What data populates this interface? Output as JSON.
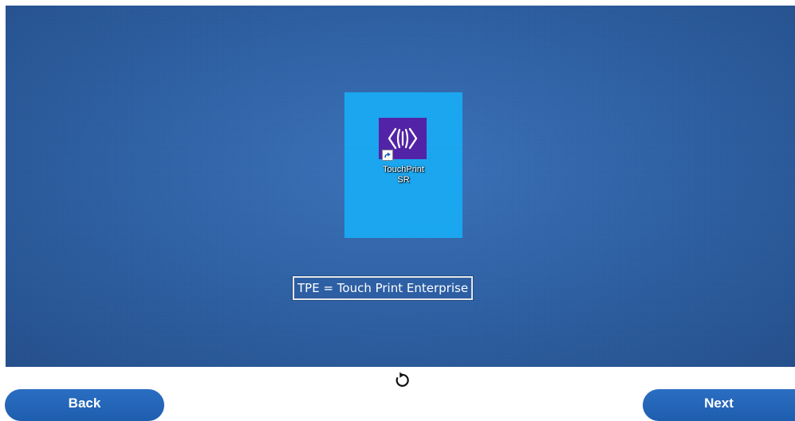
{
  "desktop_icon": {
    "label_line1": "TouchPrint",
    "label_line2": "SR",
    "icon_name": "touchprint-app-icon",
    "tile_color": "#19a6f0",
    "icon_color": "#5222a6"
  },
  "caption": {
    "text": "TPE = Touch Print Enterprise"
  },
  "controls": {
    "refresh_icon": "refresh-icon",
    "back_label": "Back",
    "next_label": "Next"
  },
  "colors": {
    "background": "#2f62a6",
    "button": "#2466b8"
  }
}
